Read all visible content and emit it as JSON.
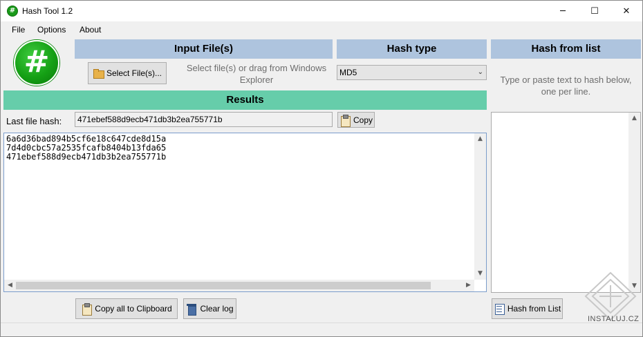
{
  "window": {
    "title": "Hash Tool 1.2",
    "minimize_glyph": "─",
    "maximize_glyph": "☐",
    "close_glyph": "✕"
  },
  "menu": {
    "file": "File",
    "options": "Options",
    "about": "About"
  },
  "logo": {
    "glyph": "#",
    "icon": "hash-logo-icon"
  },
  "input_files": {
    "header": "Input File(s)",
    "select_button": "Select File(s)...",
    "hint": "Select file(s) or drag from Windows Explorer"
  },
  "hash_type": {
    "header": "Hash type",
    "selected": "MD5"
  },
  "hash_from_list": {
    "header": "Hash from list",
    "hint": "Type or paste text to hash below, one per line.",
    "button": "Hash from List"
  },
  "results": {
    "header": "Results",
    "last_hash_label": "Last file hash:",
    "last_hash_value": "471ebef588d9ecb471db3b2ea755771b",
    "copy_button": "Copy",
    "lines": "6a6d36bad894b5cf6e18c647cde8d15a\n7d4d0cbc57a2535fcafb8404b13fda65\n471ebef588d9ecb471db3b2ea755771b",
    "copy_all_button": "Copy all to Clipboard",
    "clear_log_button": "Clear log"
  },
  "watermark": {
    "text": "INSTALUJ.CZ"
  },
  "colors": {
    "header_blue": "#aec4de",
    "results_green": "#66cdaa",
    "logo_green": "#15a015"
  }
}
